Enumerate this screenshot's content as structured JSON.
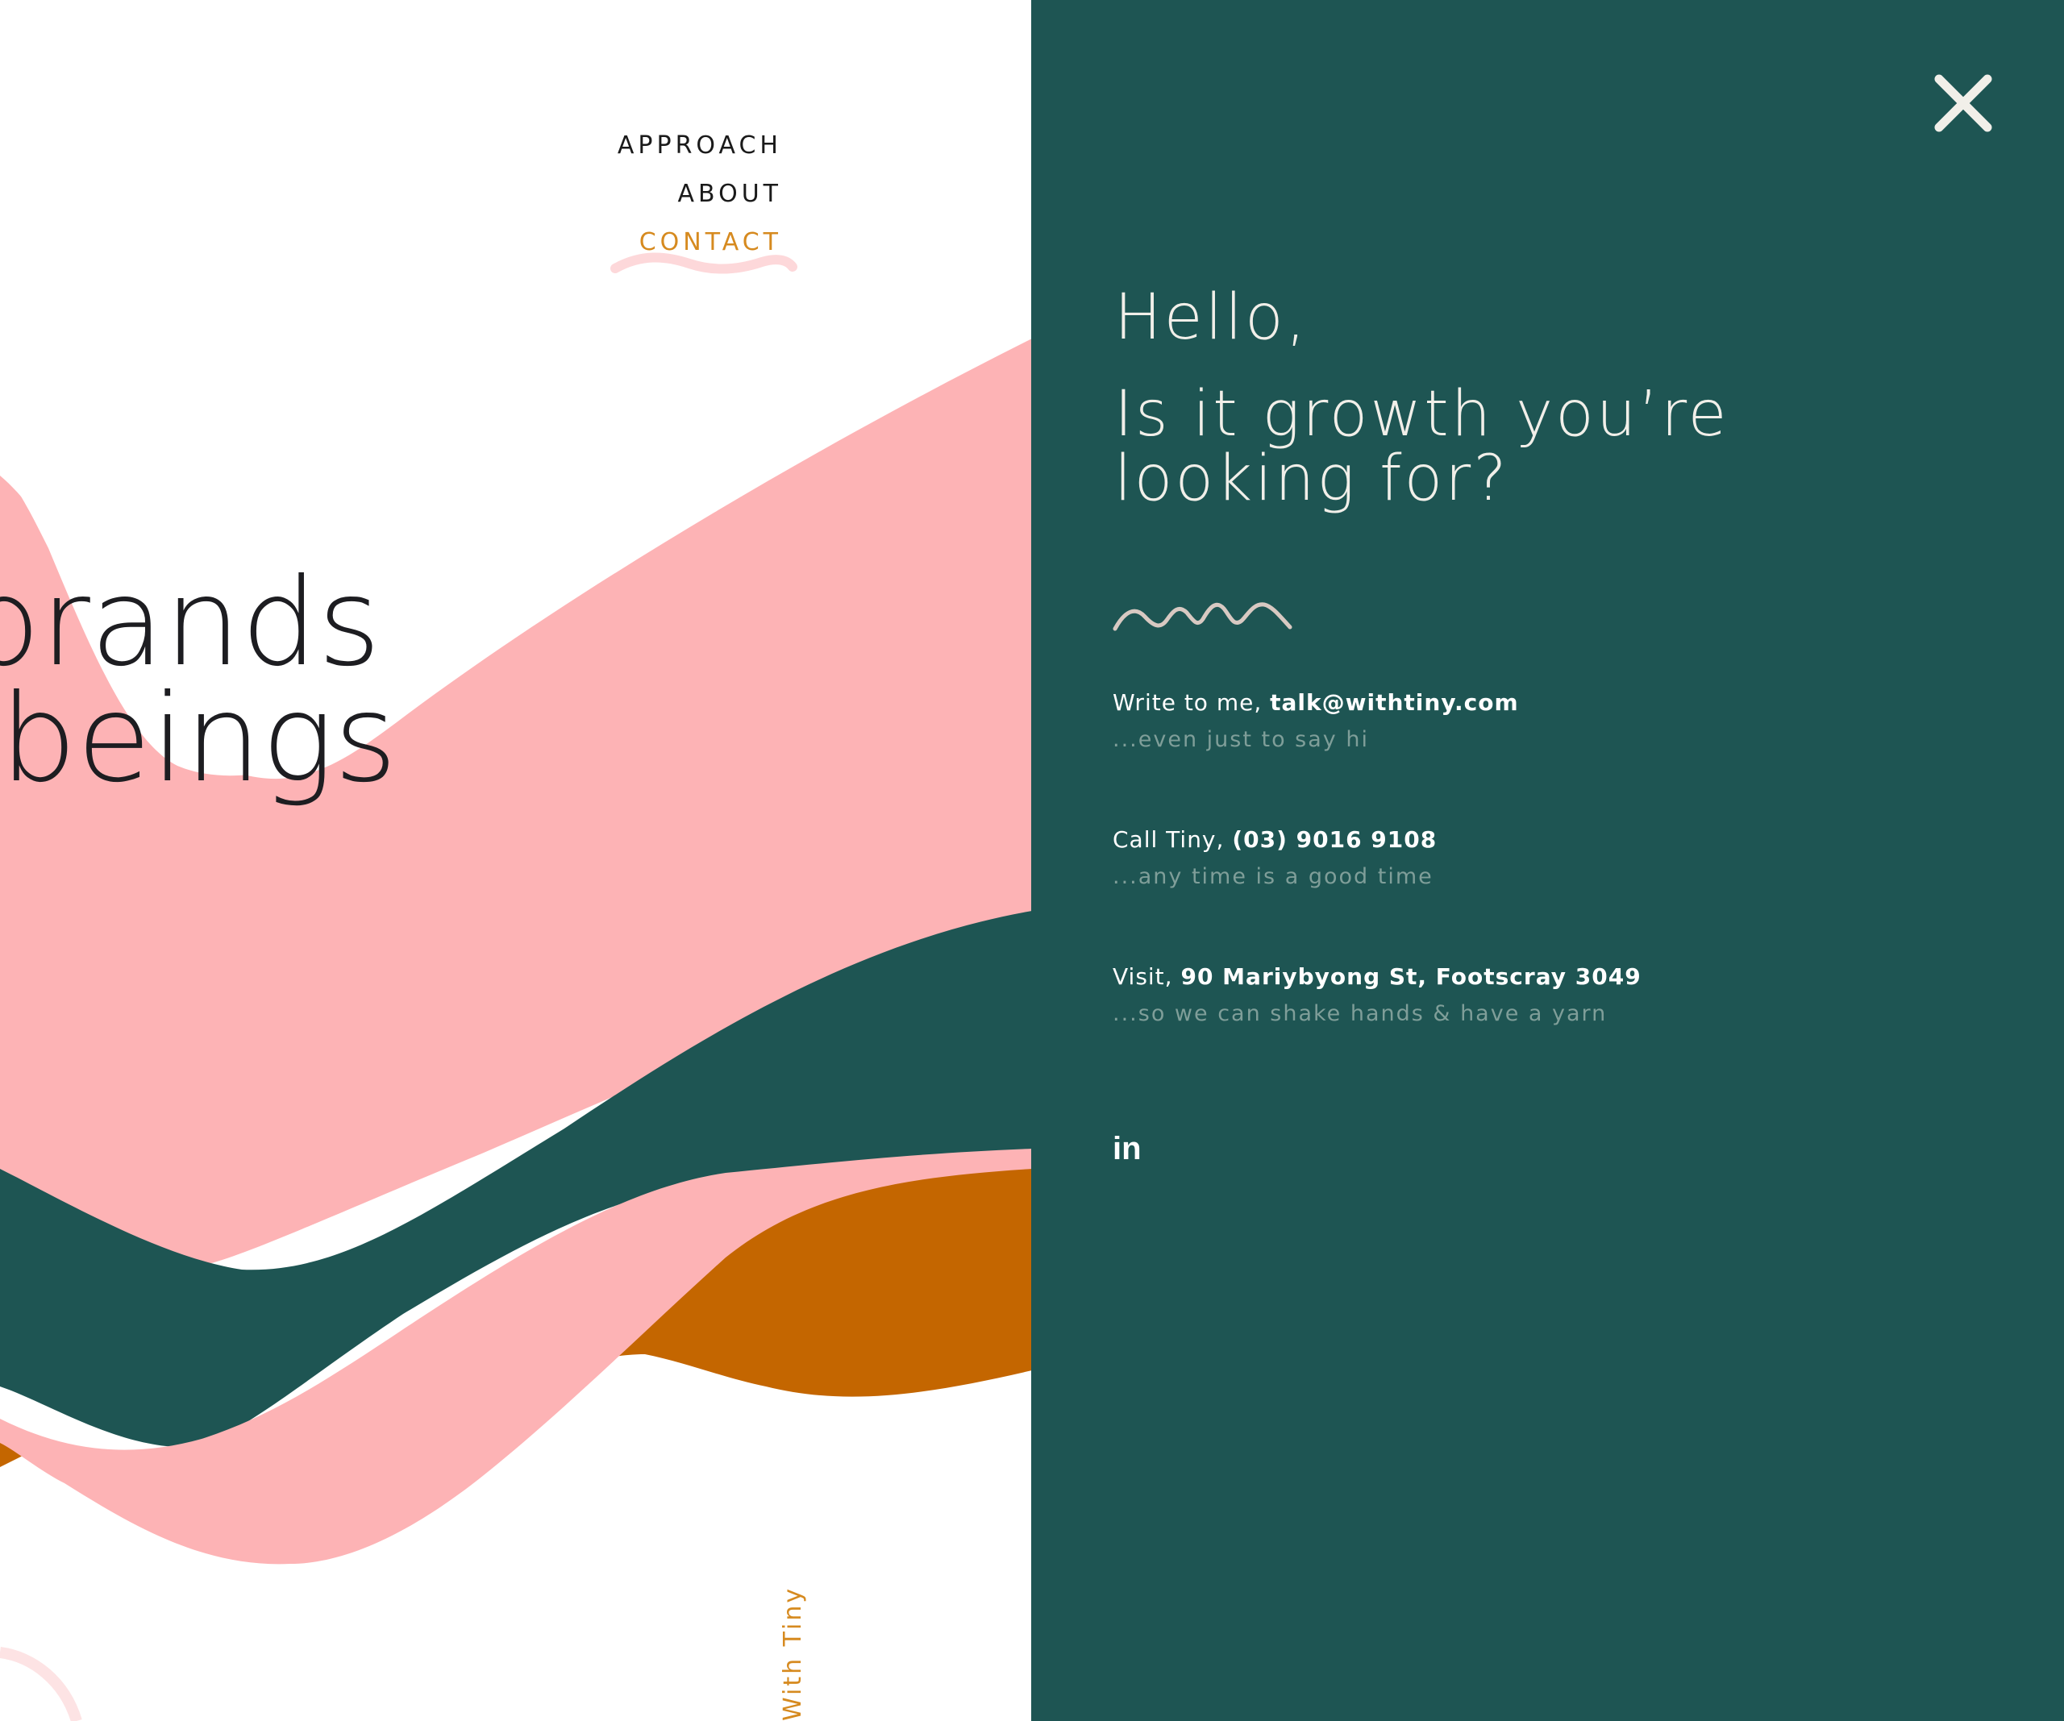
{
  "nav": {
    "items": [
      {
        "label": "APPROACH",
        "active": false
      },
      {
        "label": "ABOUT",
        "active": false
      },
      {
        "label": "CONTACT",
        "active": true
      }
    ]
  },
  "hero": {
    "line1": "brands",
    "line2": "beings"
  },
  "vertical_text": "With Tiny",
  "contact_panel": {
    "greeting": "Hello,",
    "headline_line1": "Is it growth you’re",
    "headline_line2": "looking for?",
    "write": {
      "prefix": "Write to me, ",
      "value": "talk@withtiny.com",
      "note": "...even just to say hi"
    },
    "call": {
      "prefix": "Call Tiny, ",
      "value": "(03) 9016 9108",
      "note": "...any time is a good time"
    },
    "visit": {
      "prefix": "Visit, ",
      "value": "90 Mariybyong St, Footscray 3049",
      "note": "...so we can shake hands & have a yarn"
    },
    "social_icon": "linkedin-icon",
    "close_icon": "close-icon"
  },
  "colors": {
    "panel_bg": "#1e5553",
    "pink": "#fdb3b5",
    "orange": "#c46600",
    "dark_green": "#1e5553",
    "accent": "#d68a1f",
    "text_dark": "#1d1d21"
  }
}
